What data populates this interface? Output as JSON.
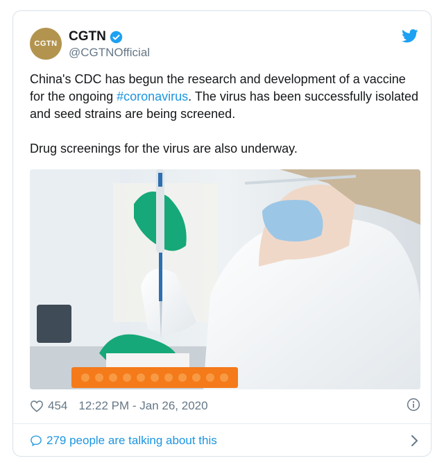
{
  "tweet": {
    "avatar_text": "CGTN",
    "display_name": "CGTN",
    "handle": "@CGTNOfficial",
    "text_before_hashtag": "China's CDC has begun the research and development of a vaccine for the ongoing ",
    "hashtag": "#coronavirus",
    "text_after_hashtag": ". The virus has been successfully isolated and seed strains are being screened.",
    "text_second_paragraph": "Drug screenings for the virus are also underway.",
    "like_count": "454",
    "timestamp": "12:22 PM - Jan 26, 2020",
    "talking_text": "279 people are talking about this"
  },
  "icons": {
    "verified": "verified-badge-icon",
    "bird": "twitter-bird-icon",
    "like": "heart-icon",
    "info": "info-icon",
    "reply": "speech-bubble-icon",
    "chevron": "chevron-right-icon"
  },
  "colors": {
    "accent": "#1b95e0",
    "avatar_bg": "#b3944f",
    "muted_text": "#657786"
  }
}
